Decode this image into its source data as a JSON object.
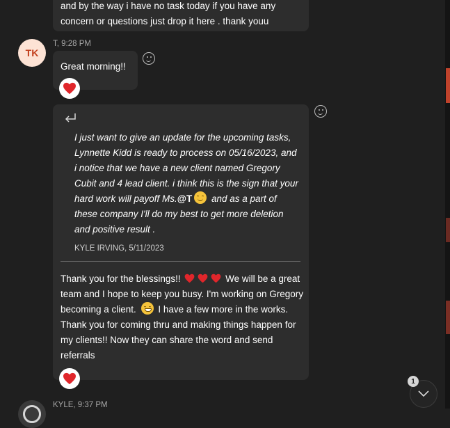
{
  "colors": {
    "background": "#1f1f1f",
    "bubble": "#2d2d2d",
    "heart": "#e0262b",
    "avatar_bg": "#fde3d5",
    "avatar_text": "#c2401d"
  },
  "messages": [
    {
      "text": "and by the way i have no task today if you have any concern or questions just drop it here . thank youu"
    },
    {
      "avatar_initials": "TK",
      "sender_meta": "T, 9:28 PM",
      "text": "Great morning!!",
      "reaction": "heart-icon"
    },
    {
      "quote": {
        "icon": "reply-arrow-icon",
        "text_before_mention": "I just want to give an update for the upcoming tasks, Lynnette Kidd is ready to process on 05/16/2023, and i notice that we have a new client named Gregory Cubit and 4 lead client. i think this is the sign that your hard work will payoff Ms.",
        "mention": "@T",
        "text_after_mention": " and as a part of these company I'll do my best to get more deletion and positive result .",
        "author_date": "KYLE IRVING, 5/11/2023"
      },
      "reply_part1": "Thank you for the blessings!!",
      "reply_part2": " We will be a great team and I hope to keep you busy. I'm working on Gregory becoming a client.",
      "reply_part3": " I have a few more in the works. Thank you for coming thru and making things happen for my clients!! Now they can share the word and send referrals",
      "reaction": "heart-icon"
    },
    {
      "sender_meta": "KYLE, 9:37 PM"
    }
  ],
  "scroll_button": {
    "badge": "1",
    "icon": "chevron-down-icon"
  }
}
